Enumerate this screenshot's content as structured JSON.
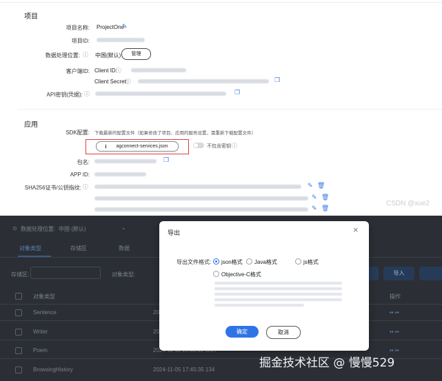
{
  "project": {
    "section_title": "项目",
    "name_label": "项目名称:",
    "name_value": "ProjectOne",
    "id_label": "项目ID:",
    "location_label": "数据处理位置:",
    "location_value": "中国(默认)",
    "manage_button": "管理",
    "client_label": "客户端ID:",
    "client_id_label": "Client ID:",
    "client_secret_label": "Client Secret:",
    "apikey_label": "API密钥(凭据):"
  },
  "app": {
    "section_title": "应用",
    "sdk_label": "SDK配置:",
    "sdk_hint": "下载最新的配置文件（如果修改了项目、应用的服务设置，需重新下载配置文件）",
    "download_button": "agconnect-services.json",
    "toggle_label": "不包含密钥",
    "package_label": "包名:",
    "appid_label": "APP ID:",
    "sha_label": "SHA256证书/公钥指纹:"
  },
  "watermarks": {
    "csdn": "CSDN @xue2",
    "juejin": "掘金技术社区 @ 慢慢529"
  },
  "background_page": {
    "location_label": "数据处理位置:",
    "location_value": "中国 (默认)",
    "tabs": [
      "对象类型",
      "存储区",
      "数据"
    ],
    "filter_label": "存储区:",
    "object_type_label": "对象类型:",
    "column_header": "对象类型",
    "ops_header": "操作",
    "import_button": "导入",
    "rows": [
      {
        "name": "Sentence",
        "time": "2024-"
      },
      {
        "name": "Writer",
        "time": "2024-"
      },
      {
        "name": "Poem",
        "time": "2024-11-11 15:43:49 GMT"
      },
      {
        "name": "BrowsingHistory",
        "time": "2024-11-05 17:45:35 134"
      }
    ]
  },
  "dialog": {
    "title": "导出",
    "format_label": "导出文件格式:",
    "options": [
      "json格式",
      "Java格式",
      "js格式",
      "Objective-C格式"
    ],
    "selected_index": 0,
    "ok_button": "确定",
    "cancel_button": "取消"
  },
  "colors": {
    "accent": "#2f74e6",
    "highlight_box": "#e03a3a",
    "overlay": "#2b2f35"
  }
}
